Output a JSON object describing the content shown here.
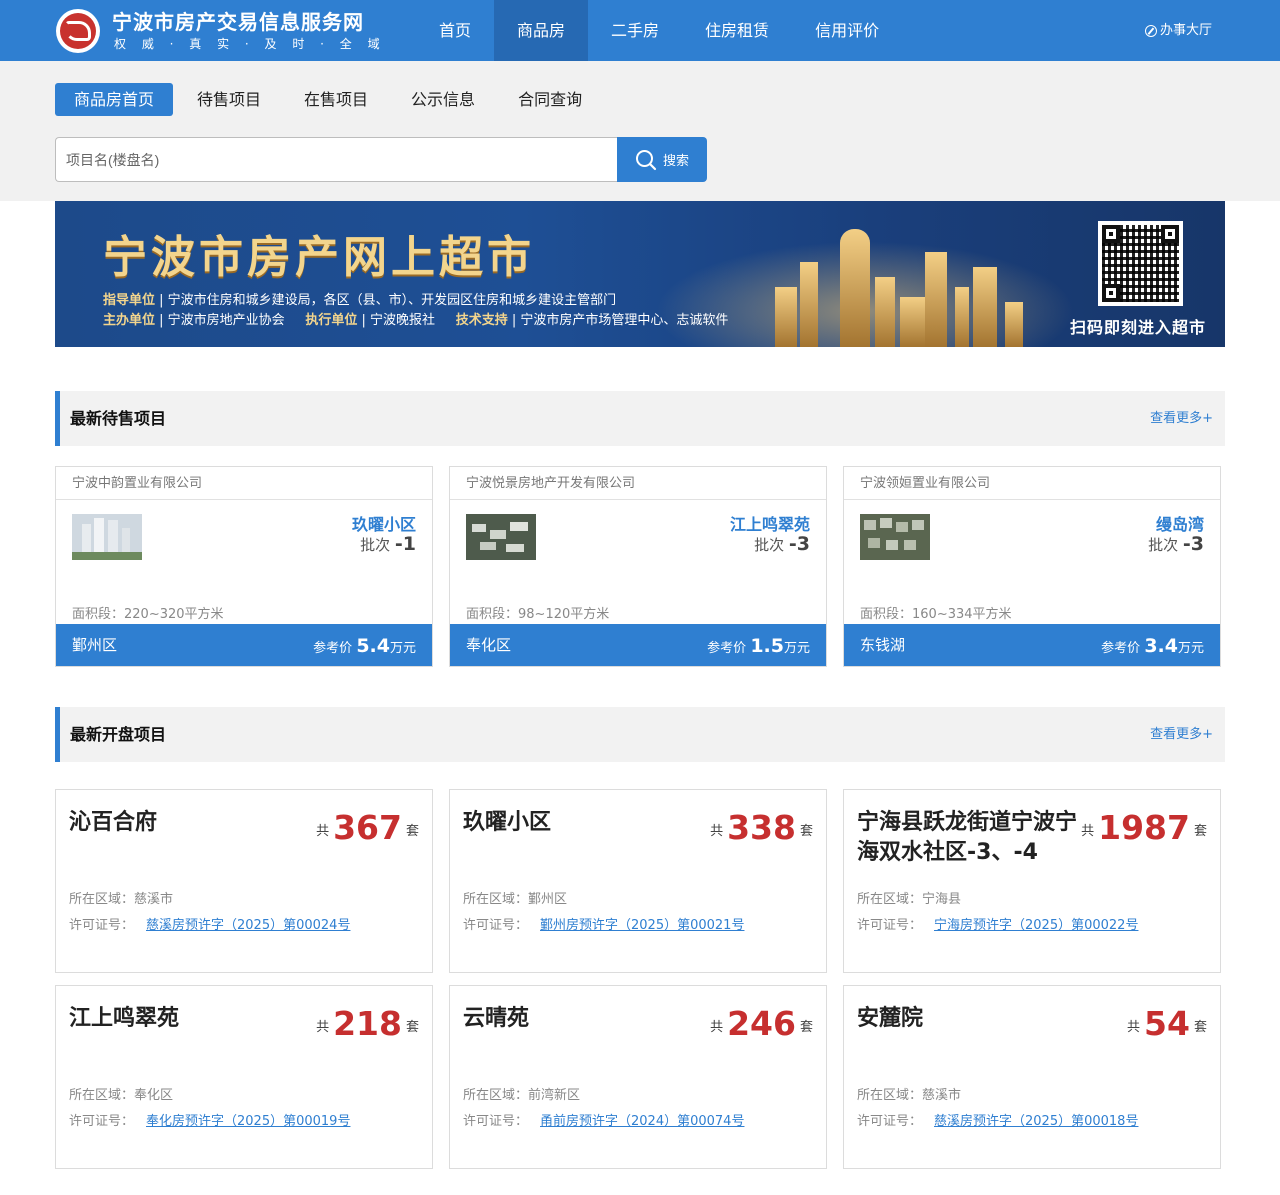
{
  "header": {
    "site_title": "宁波市房产交易信息服务网",
    "slogan": "权 威 · 真 实 · 及 时 · 全 域",
    "nav": [
      "首页",
      "商品房",
      "二手房",
      "住房租赁",
      "信用评价"
    ],
    "active_nav": "商品房",
    "office_link": "办事大厅",
    "brand_color": "#2f7fd1"
  },
  "subnav": {
    "items": [
      "商品房首页",
      "待售项目",
      "在售项目",
      "公示信息",
      "合同查询"
    ],
    "active": "商品房首页"
  },
  "search": {
    "placeholder": "项目名(楼盘名)",
    "button_label": "搜索"
  },
  "banner": {
    "title": "宁波市房产网上超市",
    "line1_label": "指导单位",
    "line1_text": "宁波市住房和城乡建设局，各区（县、市）、开发园区住房和城乡建设主管部门",
    "line2_label_a": "主办单位",
    "line2_text_a": "宁波市房地产业协会",
    "line2_label_b": "执行单位",
    "line2_text_b": "宁波晚报社",
    "line2_label_c": "技术支持",
    "line2_text_c": "宁波市房产市场管理中心、志诚软件",
    "scan_text": "扫码即刻进入超市"
  },
  "pending": {
    "title": "最新待售项目",
    "more": "查看更多+",
    "batch_label": "批次",
    "area_label": "面积段：",
    "price_label": "参考价",
    "price_unit": "万元",
    "cards": [
      {
        "developer": "宁波中韵置业有限公司",
        "name": "玖曜小区",
        "batch": "-1",
        "area": "220~320平方米",
        "district": "鄞州区",
        "price": "5.4"
      },
      {
        "developer": "宁波悦景房地产开发有限公司",
        "name": "江上鸣翠苑",
        "batch": "-3",
        "area": "98~120平方米",
        "district": "奉化区",
        "price": "1.5"
      },
      {
        "developer": "宁波领姮置业有限公司",
        "name": "缦岛湾",
        "batch": "-3",
        "area": "160~334平方米",
        "district": "东钱湖",
        "price": "3.4"
      }
    ]
  },
  "opening": {
    "title": "最新开盘项目",
    "more": "查看更多+",
    "count_prefix": "共",
    "count_suffix": "套",
    "region_label": "所在区域：",
    "license_label": "许可证号：",
    "cards": [
      {
        "name": "沁百合府",
        "count": "367",
        "region": "慈溪市",
        "license": "慈溪房预许字（2025）第00024号"
      },
      {
        "name": "玖曜小区",
        "count": "338",
        "region": "鄞州区",
        "license": "鄞州房预许字（2025）第00021号"
      },
      {
        "name": "宁海县跃龙街道宁波宁海双水社区-3、-4",
        "count": "1987",
        "region": "宁海县",
        "license": "宁海房预许字（2025）第00022号"
      },
      {
        "name": "江上鸣翠苑",
        "count": "218",
        "region": "奉化区",
        "license": "奉化房预许字（2025）第00019号"
      },
      {
        "name": "云晴苑",
        "count": "246",
        "region": "前湾新区",
        "license": "甬前房预许字（2024）第00074号"
      },
      {
        "name": "安麓院",
        "count": "54",
        "region": "慈溪市",
        "license": "慈溪房预许字（2025）第00018号"
      }
    ]
  }
}
